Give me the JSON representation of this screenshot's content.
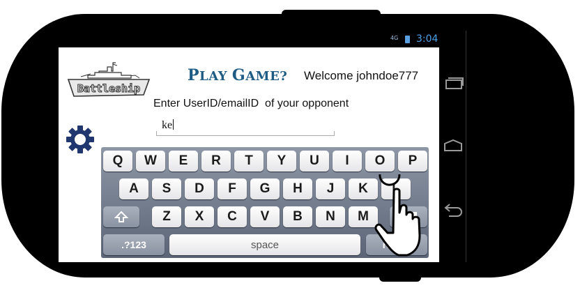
{
  "status_bar": {
    "network": "4G",
    "time": "3:04"
  },
  "header": {
    "logo_text": "Battleship",
    "title_first": "P",
    "title_rest": "LAY ",
    "title_g": "G",
    "title_rest2": "AME?",
    "welcome": "Welcome johndoe777"
  },
  "form": {
    "prompt": "Enter UserID/emailID  of your opponent",
    "opponent_value": "ke"
  },
  "keyboard": {
    "row1": [
      "Q",
      "W",
      "E",
      "R",
      "T",
      "Y",
      "U",
      "I",
      "O",
      "P"
    ],
    "row2": [
      "A",
      "S",
      "D",
      "F",
      "G",
      "H",
      "J",
      "K",
      "L"
    ],
    "row3": [
      "Z",
      "X",
      "C",
      "V",
      "B",
      "N",
      "M"
    ],
    "numbers_label": ".?123",
    "space_label": "space",
    "return_label": "return"
  },
  "icons": [
    "settings-gear-icon",
    "shift-icon",
    "backspace-icon",
    "recent-apps-icon",
    "home-icon",
    "back-icon",
    "touch-hand-icon"
  ],
  "colors": {
    "title": "#1f5c84",
    "gear": "#20366e",
    "time": "#4da0e6"
  }
}
